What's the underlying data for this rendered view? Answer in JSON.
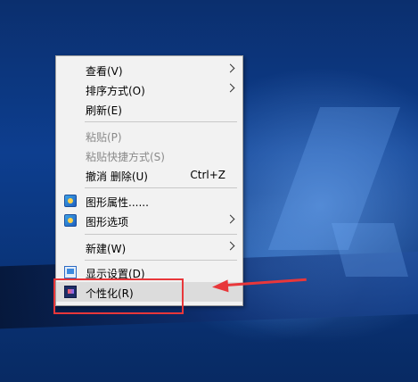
{
  "context_menu": {
    "items": [
      {
        "label": "查看(V)",
        "has_submenu": true
      },
      {
        "label": "排序方式(O)",
        "has_submenu": true
      },
      {
        "label": "刷新(E)"
      },
      {
        "label": "粘贴(P)",
        "disabled": true
      },
      {
        "label": "粘贴快捷方式(S)",
        "disabled": true
      },
      {
        "label": "撤消 删除(U)",
        "shortcut": "Ctrl+Z"
      },
      {
        "label": "图形属性......",
        "icon": "graphics-properties-icon"
      },
      {
        "label": "图形选项",
        "icon": "graphics-options-icon",
        "has_submenu": true
      },
      {
        "label": "新建(W)",
        "has_submenu": true
      },
      {
        "label": "显示设置(D)",
        "icon": "display-settings-icon"
      },
      {
        "label": "个性化(R)",
        "icon": "personalize-icon",
        "highlighted": true
      }
    ]
  },
  "annotation": {
    "color": "#e8373a"
  }
}
